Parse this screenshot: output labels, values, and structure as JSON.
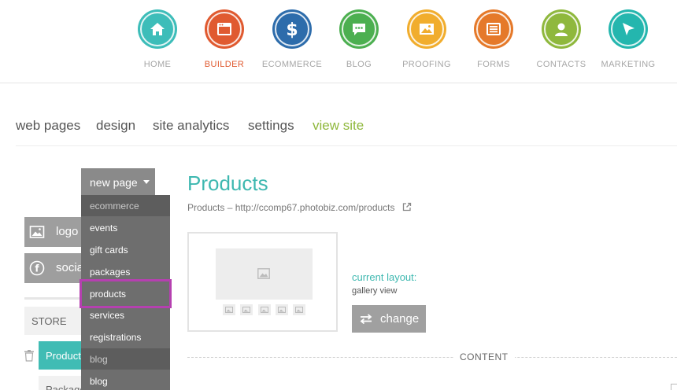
{
  "topnav": {
    "items": [
      {
        "label": "HOME",
        "color": "#3dbdb9",
        "icon": "home-icon"
      },
      {
        "label": "BUILDER",
        "color": "#e05a30",
        "icon": "builder-icon"
      },
      {
        "label": "ECOMMERCE",
        "color": "#2d6cab",
        "icon": "dollar-icon"
      },
      {
        "label": "BLOG",
        "color": "#4caf50",
        "icon": "chat-icon"
      },
      {
        "label": "PROOFING",
        "color": "#f1ad2d",
        "icon": "image-icon"
      },
      {
        "label": "FORMS",
        "color": "#e5792a",
        "icon": "list-icon"
      },
      {
        "label": "CONTACTS",
        "color": "#8fb83d",
        "icon": "user-icon"
      },
      {
        "label": "MARKETING",
        "color": "#24b6ae",
        "icon": "cursor-icon"
      }
    ],
    "active_index": 1
  },
  "subnav": {
    "web_pages": "web pages",
    "design": "design",
    "site_analytics": "site analytics",
    "settings": "settings",
    "view_site": "view site"
  },
  "sidebar": {
    "logo_label": "logo",
    "social_label": "socia",
    "store_label": "STORE",
    "products_label": "Products",
    "packages_label": "Package"
  },
  "new_page": {
    "label": "new page",
    "menu": [
      {
        "label": "ecommerce",
        "header": true
      },
      {
        "label": "events",
        "header": false
      },
      {
        "label": "gift cards",
        "header": false
      },
      {
        "label": "packages",
        "header": false
      },
      {
        "label": "products",
        "header": false,
        "highlighted": true
      },
      {
        "label": "services",
        "header": false
      },
      {
        "label": "registrations",
        "header": false
      },
      {
        "label": "blog",
        "header": true
      },
      {
        "label": "blog",
        "header": false
      }
    ]
  },
  "page": {
    "title": "Products",
    "breadcrumb_name": "Products",
    "breadcrumb_sep": "–",
    "url": "http://ccomp67.photobiz.com/products",
    "current_layout_label": "current layout:",
    "layout_name": "gallery view",
    "change_label": "change",
    "content_label": "CONTENT"
  },
  "colors": {
    "accent_teal": "#3eb8b0",
    "view_site_green": "#8fb83d",
    "highlight_magenta": "#b540b0"
  }
}
